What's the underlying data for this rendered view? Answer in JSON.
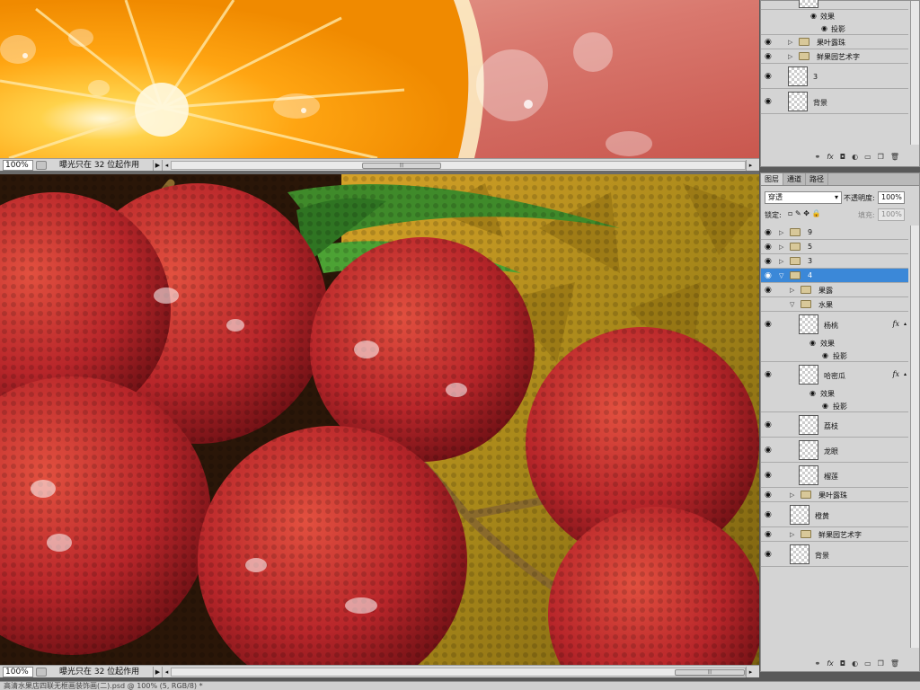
{
  "top_document": {
    "zoom": "100%",
    "status_text": "曝光只在 32 位起作用"
  },
  "bottom_document": {
    "zoom": "100%",
    "status_text": "曝光只在 32 位起作用"
  },
  "top_layers_panel": {
    "layers": [
      {
        "name": "效果",
        "kind": "effect-group"
      },
      {
        "name": "投影",
        "kind": "effect"
      },
      {
        "name": "果叶露珠",
        "kind": "folder"
      },
      {
        "name": "鲜果园艺术字",
        "kind": "folder"
      },
      {
        "name": "3",
        "kind": "layer"
      },
      {
        "name": "背景",
        "kind": "layer"
      }
    ]
  },
  "layers_panel": {
    "tabs": [
      "图层",
      "通道",
      "路径"
    ],
    "blend_mode": "穿透",
    "opacity_label": "不透明度:",
    "opacity_value": "100%",
    "lock_label": "锁定:",
    "fill_label": "填充:",
    "fill_value": "100%",
    "layers": [
      {
        "name": "9",
        "kind": "folder"
      },
      {
        "name": "5",
        "kind": "folder"
      },
      {
        "name": "3",
        "kind": "folder"
      },
      {
        "name": "4",
        "kind": "folder-open",
        "selected": true
      },
      {
        "name": "果露",
        "kind": "folder"
      },
      {
        "name": "水果",
        "kind": "folder-open"
      },
      {
        "name": "杨桃",
        "kind": "layer",
        "fx": "fx"
      },
      {
        "name": "效果",
        "kind": "effect-group"
      },
      {
        "name": "投影",
        "kind": "effect"
      },
      {
        "name": "哈密瓜",
        "kind": "layer",
        "fx": "fx"
      },
      {
        "name": "效果",
        "kind": "effect-group"
      },
      {
        "name": "投影",
        "kind": "effect"
      },
      {
        "name": "荔枝",
        "kind": "layer"
      },
      {
        "name": "龙眼",
        "kind": "layer"
      },
      {
        "name": "榴莲",
        "kind": "layer"
      },
      {
        "name": "果叶露珠",
        "kind": "folder"
      },
      {
        "name": "橙黄",
        "kind": "layer"
      },
      {
        "name": "鲜果园艺术字",
        "kind": "folder"
      },
      {
        "name": "背景",
        "kind": "layer"
      }
    ]
  },
  "taskbar": {
    "title": "高清水果店四联无框画装饰画(二).psd @ 100% (5, RGB/8) *"
  },
  "colors": {
    "selection": "#3b88d8",
    "panel_bg": "#d4d4d4"
  }
}
